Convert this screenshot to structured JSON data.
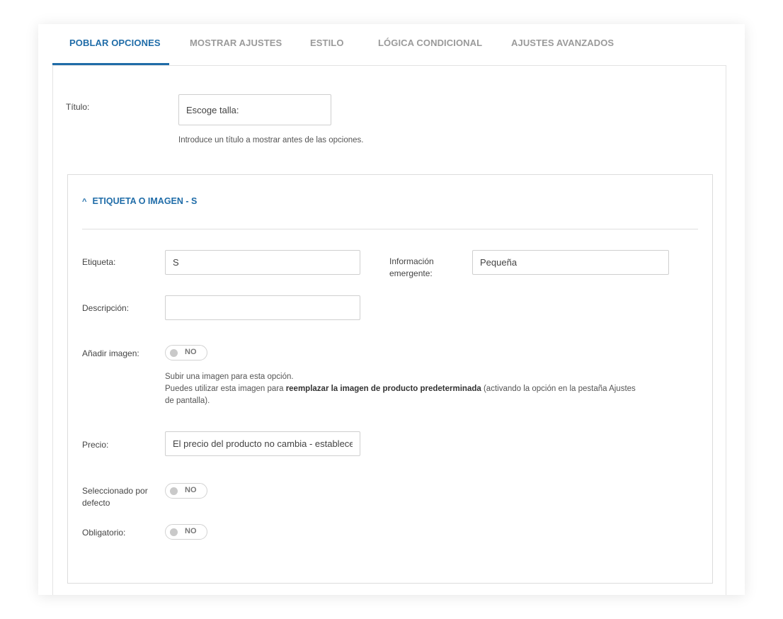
{
  "tabs": [
    {
      "label": "POBLAR OPCIONES",
      "active": true
    },
    {
      "label": "MOSTRAR AJUSTES",
      "active": false
    },
    {
      "label": "ESTILO",
      "active": false
    },
    {
      "label": "LÓGICA CONDICIONAL",
      "active": false
    },
    {
      "label": "AJUSTES AVANZADOS",
      "active": false
    }
  ],
  "title_field": {
    "label": "Título:",
    "value": "Escoge talla:",
    "help": "Introduce un título a mostrar antes de las opciones."
  },
  "option": {
    "header": "ETIQUETA O IMAGEN - S",
    "etiqueta": {
      "label": "Etiqueta:",
      "value": "S"
    },
    "tooltip": {
      "label_line1": "Información",
      "label_line2": "emergente:",
      "value": "Pequeña"
    },
    "descripcion": {
      "label": "Descripción:",
      "value": ""
    },
    "imagen": {
      "label": "Añadir imagen:",
      "toggle": "NO",
      "help_line1": "Subir una imagen para esta opción.",
      "help_line2_pre": "Puedes utilizar esta imagen para ",
      "help_line2_bold": "reemplazar la imagen de producto predeterminada",
      "help_line2_post": " (activando la opción en la pestaña Ajustes",
      "help_line3": "de pantalla)."
    },
    "precio": {
      "label": "Precio:",
      "value": "El precio del producto no cambia - establecer"
    },
    "default": {
      "label_line1": "Seleccionado por",
      "label_line2": "defecto",
      "toggle": "NO"
    },
    "obligatorio": {
      "label": "Obligatorio:",
      "toggle": "NO"
    }
  },
  "colors": {
    "accent": "#1f6ca8",
    "tab_inactive": "#9a9a9a"
  }
}
